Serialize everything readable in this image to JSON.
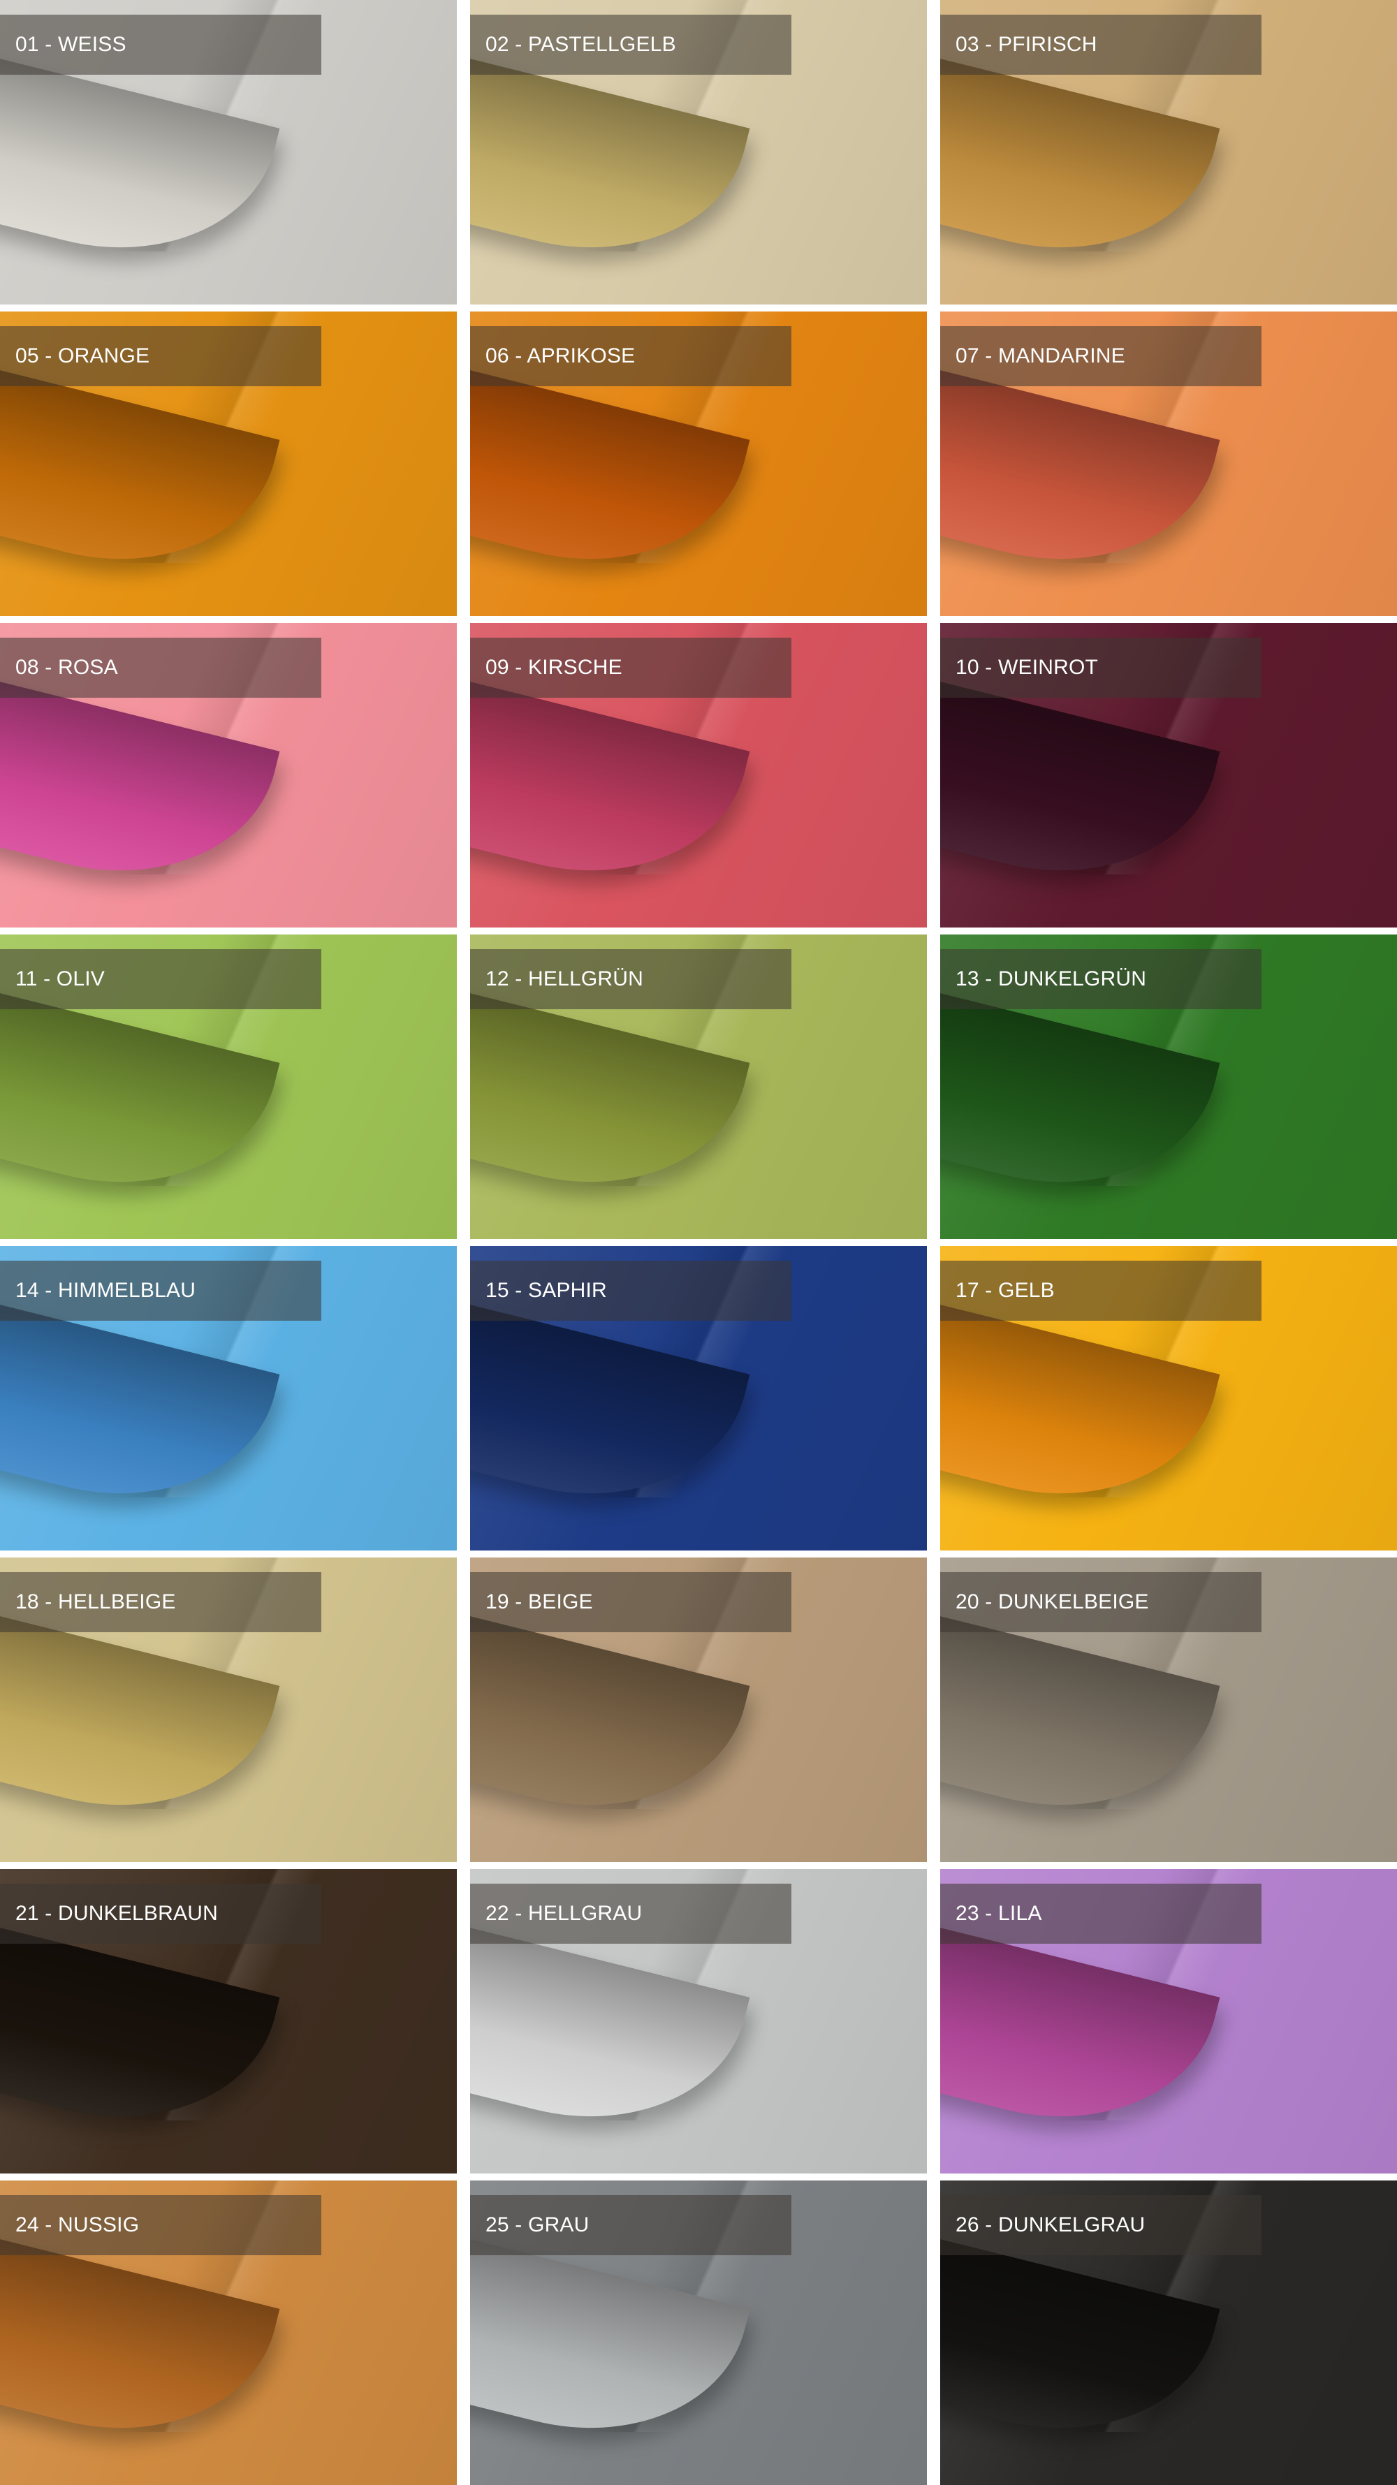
{
  "swatches": [
    {
      "label": "01 - WEISS",
      "base": "#cfcdc8",
      "curl": "#dbd8d1"
    },
    {
      "label": "02 - PASTELLGELB",
      "base": "#d8cba8",
      "curl": "#c9b36a"
    },
    {
      "label": "03 - PFIRISCH",
      "base": "#d2b07a",
      "curl": "#c89340"
    },
    {
      "label": "05 - ORANGE",
      "base": "#e59212",
      "curl": "#c96f08"
    },
    {
      "label": "06 - APRIKOSE",
      "base": "#e48512",
      "curl": "#c95a08"
    },
    {
      "label": "07 - MANDARINE",
      "base": "#ee8f4e",
      "curl": "#d35a3e"
    },
    {
      "label": "08 - ROSA",
      "base": "#f3909a",
      "curl": "#d8489a"
    },
    {
      "label": "09 - KIRSCHE",
      "base": "#d9545f",
      "curl": "#c63e64"
    },
    {
      "label": "10 - WEINROT",
      "base": "#5e1a2e",
      "curl": "#3a0f22"
    },
    {
      "label": "11 - OLIV",
      "base": "#9fc555",
      "curl": "#7fa03a"
    },
    {
      "label": "12 - HELLGRÜN",
      "base": "#a9b85a",
      "curl": "#8d9c3a"
    },
    {
      "label": "13 - DUNKELGRÜN",
      "base": "#2f7a25",
      "curl": "#1f5a1a"
    },
    {
      "label": "14 - HIMMELBLAU",
      "base": "#5cb2e5",
      "curl": "#3d86c9"
    },
    {
      "label": "15 - SAPHIR",
      "base": "#1d3b86",
      "curl": "#142a63"
    },
    {
      "label": "17 - GELB",
      "base": "#f6b212",
      "curl": "#e88a0d"
    },
    {
      "label": "18 - HELLBEIGE",
      "base": "#d2c38e",
      "curl": "#c9b060"
    },
    {
      "label": "19 - BEIGE",
      "base": "#b99c7a",
      "curl": "#8a7050"
    },
    {
      "label": "20 - DUNKELBEIGE",
      "base": "#a49a8a",
      "curl": "#857b6c"
    },
    {
      "label": "21 - DUNKELBRAUN",
      "base": "#3f2e20",
      "curl": "#1c140d"
    },
    {
      "label": "22 - HELLGRAU",
      "base": "#c4c6c6",
      "curl": "#d8d9d8"
    },
    {
      "label": "23 - LILA",
      "base": "#b482cf",
      "curl": "#b5489c"
    },
    {
      "label": "24 - NUSSIG",
      "base": "#cf8a40",
      "curl": "#b86a22"
    },
    {
      "label": "25 - GRAU",
      "base": "#7c8083",
      "curl": "#b9bcbd"
    },
    {
      "label": "26 - DUNKELGRAU",
      "base": "#2a2826",
      "curl": "#141311"
    }
  ]
}
